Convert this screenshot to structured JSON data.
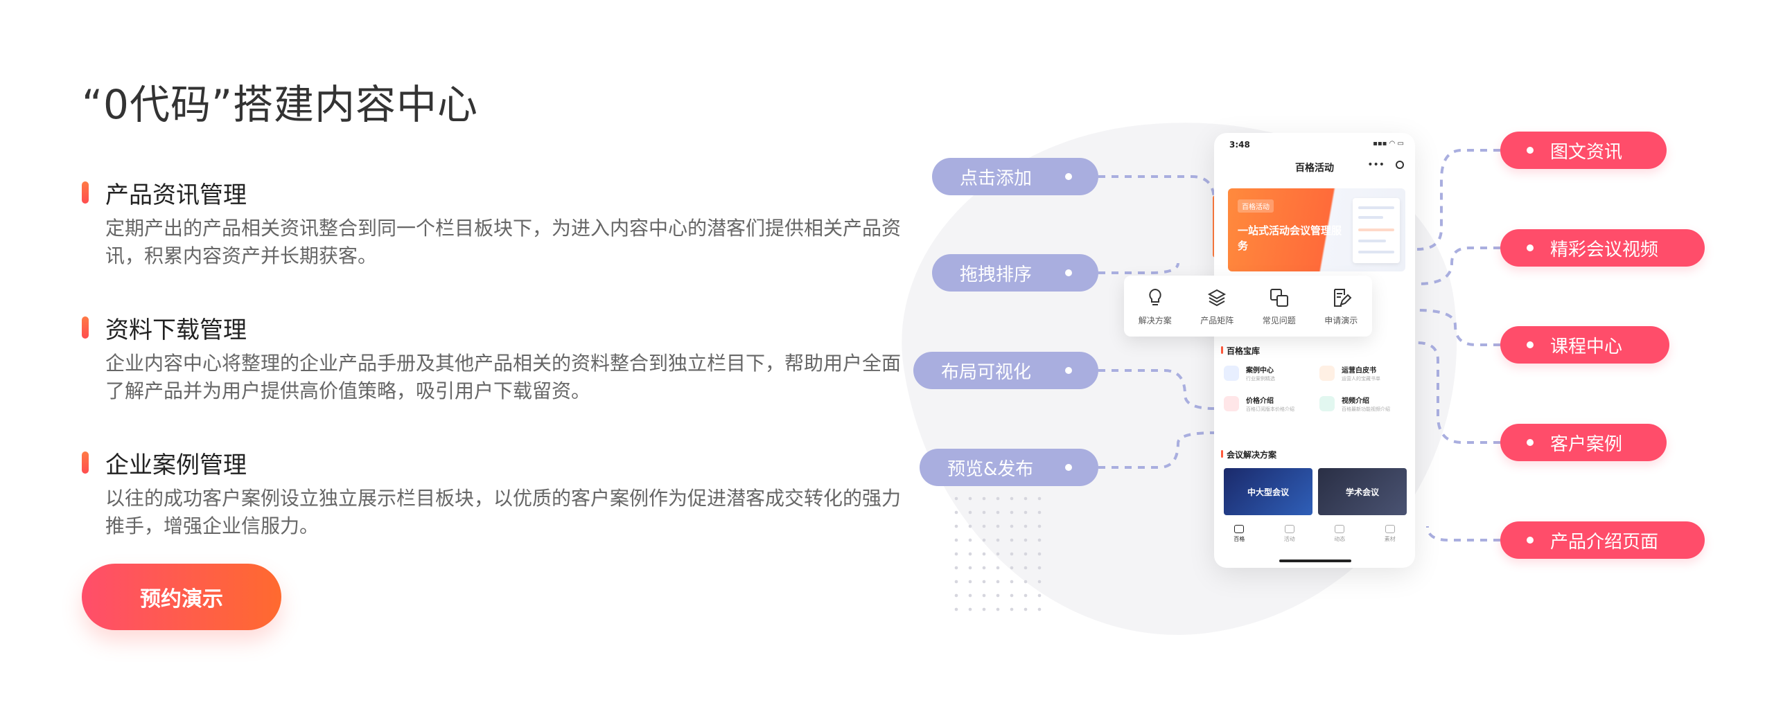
{
  "headline": "“0代码”搭建内容中心",
  "features": [
    {
      "title": "产品资讯管理",
      "desc": "定期产出的产品相关资讯整合到同一个栏目板块下，为进入内容中心的潜客们提供相关产品资讯，积累内容资产并长期获客。"
    },
    {
      "title": "资料下载管理",
      "desc": "企业内容中心将整理的企业产品手册及其他产品相关的资料整合到独立栏目下，帮助用户全面了解产品并为用户提供高价值策略，吸引用户下载留资。"
    },
    {
      "title": "企业案例管理",
      "desc": "以往的成功客户案例设立独立展示栏目板块，以优质的客户案例作为促进潜客成交转化的强力推手，增强企业信服力。"
    }
  ],
  "cta_label": "预约演示",
  "left_actions": [
    "点击添加",
    "拖拽排序",
    "布局可视化",
    "预览&发布"
  ],
  "right_modules": [
    "图文资讯",
    "精彩会议视频",
    "课程中心",
    "客户案例",
    "产品介绍页面"
  ],
  "phone": {
    "time": "3:48",
    "status_icons": "▪▪▪ ◠ ▭",
    "title": "百格活动",
    "menu": "•••",
    "banner_logo": "百格活动",
    "banner_text": "一站式活动会议管理服务",
    "quick_items": [
      {
        "label": "解决方案",
        "icon": "bulb-icon"
      },
      {
        "label": "产品矩阵",
        "icon": "layers-icon"
      },
      {
        "label": "常见问题",
        "icon": "translate-icon"
      },
      {
        "label": "申请演示",
        "icon": "edit-icon"
      }
    ],
    "library_title": "百格宝库",
    "library": [
      {
        "title": "案例中心",
        "sub": "行业案例精选",
        "color": "#5b8cff"
      },
      {
        "title": "运营白皮书",
        "sub": "运营人的宝藏书单",
        "color": "#ff8a3d"
      },
      {
        "title": "价格介绍",
        "sub": "百格订阅版本价格介绍",
        "color": "#ff5a6a"
      },
      {
        "title": "视频介绍",
        "sub": "百格最新功能视频介绍",
        "color": "#3dc9a0"
      }
    ],
    "solutions_title": "会议解决方案",
    "solutions": [
      "中大型会议",
      "学术会议"
    ],
    "tabs": [
      "百格",
      "活动",
      "动态",
      "素材"
    ]
  }
}
